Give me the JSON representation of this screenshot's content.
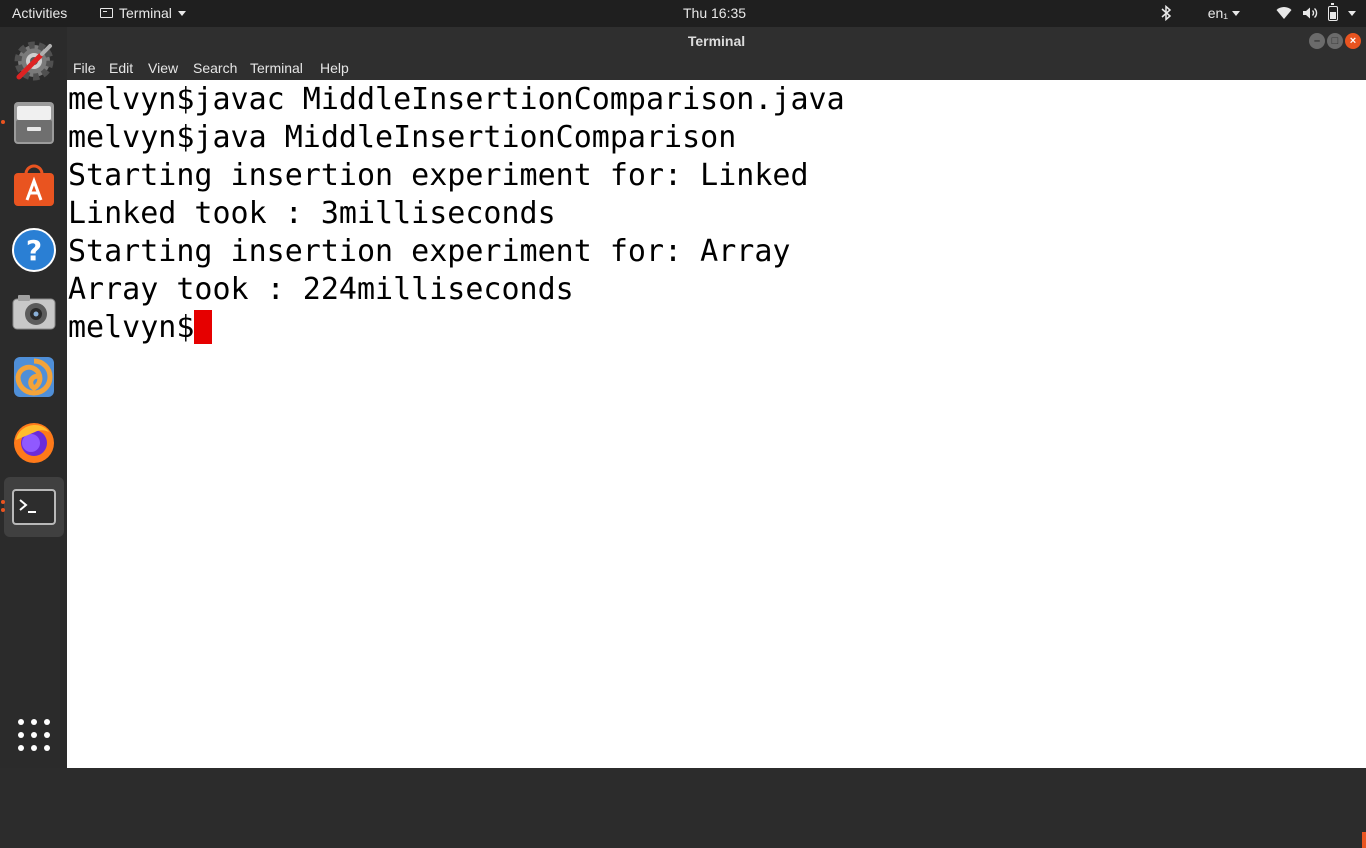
{
  "topbar": {
    "activities": "Activities",
    "app_menu": "Terminal",
    "clock": "Thu 16:35",
    "keyboard_layout": "en₁"
  },
  "window": {
    "title": "Terminal"
  },
  "menu": [
    "File",
    "Edit",
    "View",
    "Search",
    "Terminal",
    "Help"
  ],
  "terminal": {
    "lines": [
      "melvyn$javac MiddleInsertionComparison.java",
      "melvyn$java MiddleInsertionComparison",
      "Starting insertion experiment for: Linked",
      "Linked took : 3milliseconds",
      "Starting insertion experiment for: Array",
      "Array took : 224milliseconds"
    ],
    "prompt": "melvyn$"
  },
  "dock": [
    "settings-icon",
    "files-icon",
    "software-icon",
    "help-icon",
    "camera-icon",
    "meld-icon",
    "firefox-icon",
    "terminal-icon",
    "app-grid-icon"
  ],
  "colors": {
    "accent": "#e95420",
    "cursor": "#e60000"
  }
}
